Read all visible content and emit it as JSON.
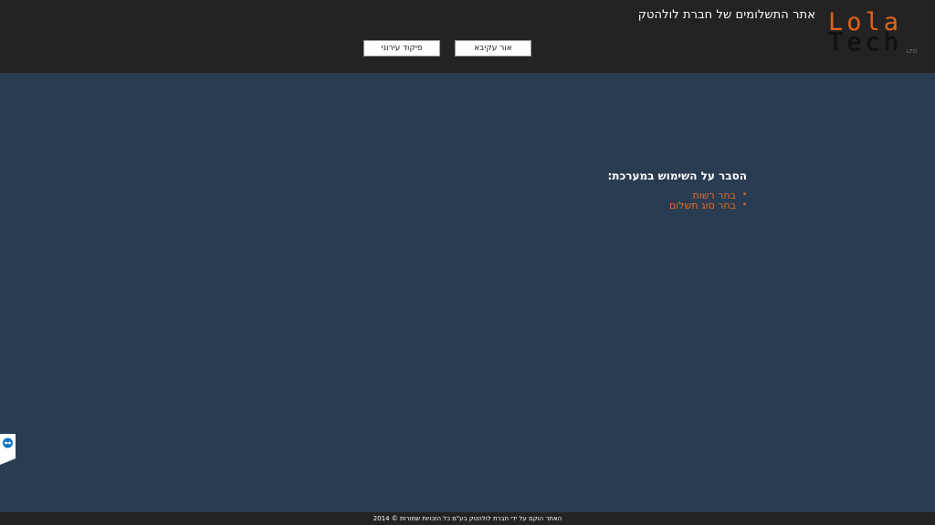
{
  "header": {
    "site_title": "אתר התשלומים של חברת לולהטק",
    "logo": {
      "line1": "Lola",
      "line2": "Tech",
      "suffix": "LTD",
      "accent_color": "#e0631c"
    },
    "nav": {
      "or_label": "אור עקיבא",
      "command_label": "פיקוד עירוני"
    }
  },
  "help": {
    "heading": "הסבר על השימוש במערכת:",
    "items": [
      {
        "label": "בחר רשות"
      },
      {
        "label": "בחר סוג תשלום"
      }
    ]
  },
  "side_tab": {
    "icon": "remote-support-icon"
  },
  "footer": {
    "text": "האתר הוקם על ידי חברת לולהטק בע\"מ כל הזכויות שמורות © 2014"
  },
  "colors": {
    "background": "#293c51",
    "header": "#232323",
    "accent": "#e66a24"
  }
}
